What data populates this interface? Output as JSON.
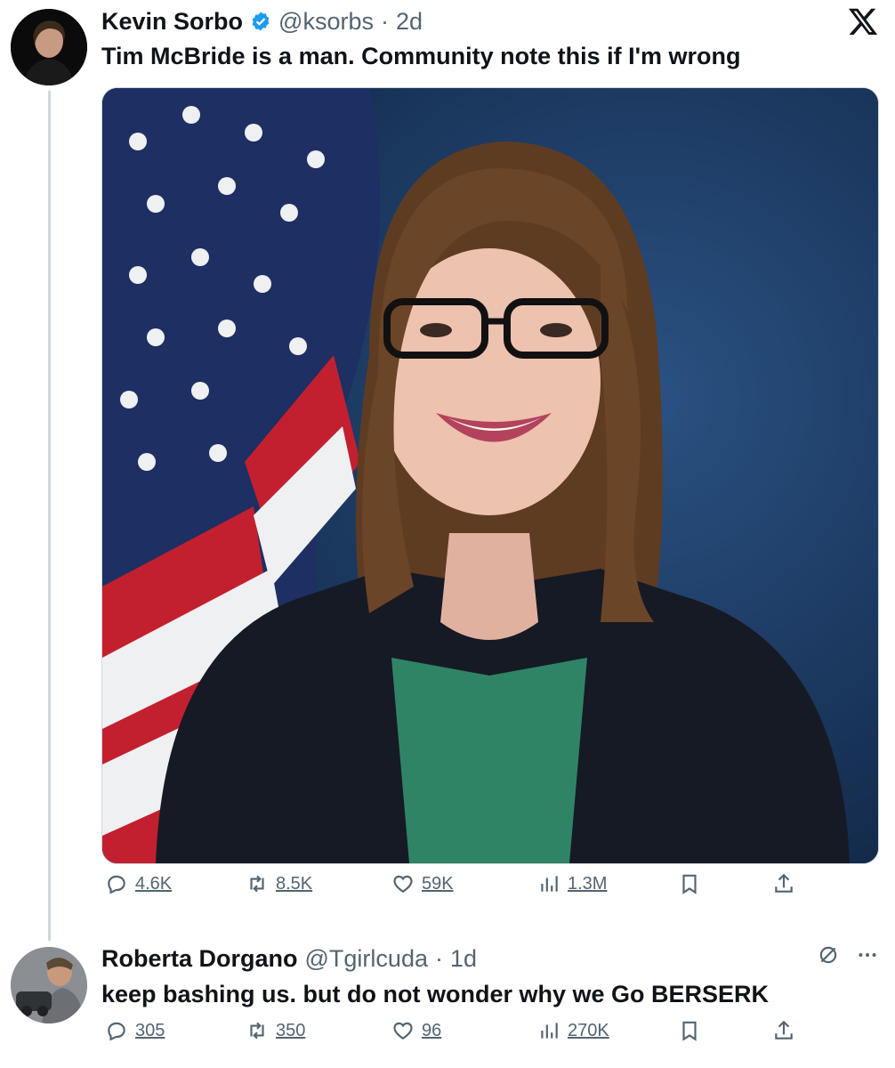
{
  "tweet": {
    "author_name": "Kevin Sorbo",
    "author_handle": "@ksorbs",
    "separator": "·",
    "time": "2d",
    "text": "Tim McBride is a man. Community note this if I'm wrong",
    "actions": {
      "replies": "4.6K",
      "retweets": "8.5K",
      "likes": "59K",
      "views": "1.3M"
    },
    "icons": {
      "verified": "verified-badge-icon",
      "logo": "x-logo-icon"
    }
  },
  "reply": {
    "author_name": "Roberta Dorgano",
    "author_handle": "@Tgirlcuda",
    "separator": "·",
    "time": "1d",
    "text": "keep bashing us. but do not wonder why we Go BERSERK",
    "actions": {
      "replies": "305",
      "retweets": "350",
      "likes": "96",
      "views": "270K"
    }
  },
  "colors": {
    "accent": "#1d9bf0",
    "muted": "#536471",
    "text": "#0f1419"
  }
}
